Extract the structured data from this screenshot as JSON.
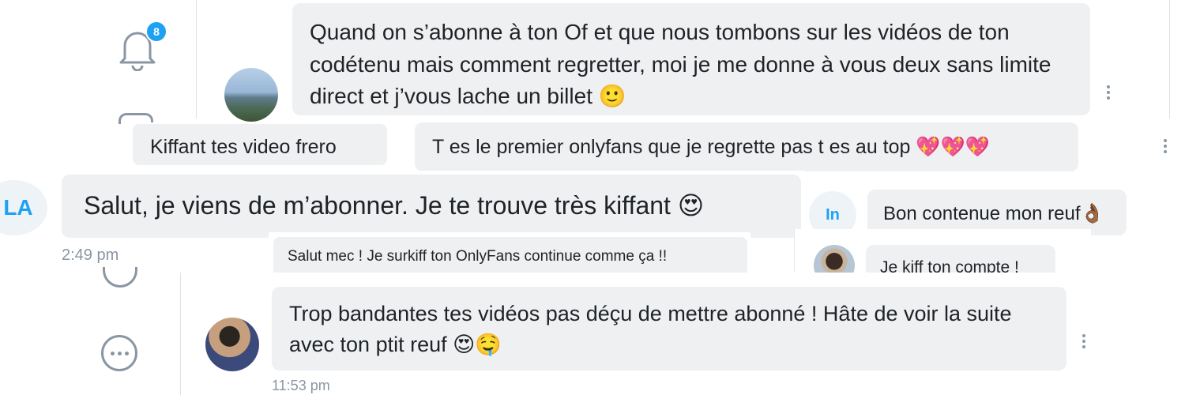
{
  "notifications": {
    "badge_count": "8",
    "icon": "bell-icon"
  },
  "messages": [
    {
      "text": "Quand on s’abonne à ton Of et que nous tombons sur les vidéos de ton codétenu mais comment regretter, moi je me donne à vous deux sans limite direct et j’vous lache un billet",
      "emoji": "🙂",
      "avatar": "landscape-photo"
    },
    {
      "text": "Kiffant tes video frero"
    },
    {
      "text": "T es le premier onlyfans que je regrette pas t es au top",
      "emoji": "💖💖💖"
    },
    {
      "text": "Salut, je viens de m’abonner. Je te trouve très kiffant",
      "emoji": "😍",
      "avatar_initials": "LA",
      "time": "2:49 pm"
    },
    {
      "text": "Bon contenue mon reuf",
      "emoji": "👌🏾",
      "avatar_initials": "In"
    },
    {
      "text": "Salut mec ! Je surkiff ton OnlyFans continue comme ça !!"
    },
    {
      "text": "Je kiff ton compte !",
      "avatar": "person-photo"
    },
    {
      "text": "Trop bandantes tes vidéos pas déçu de mettre abonné ! Hâte de voir la suite avec ton ptit reuf",
      "emoji": "😍🤤",
      "avatar": "sunglasses-person-photo",
      "time": "11:53 pm"
    }
  ],
  "colors": {
    "bubble": "#eef0f2",
    "accent": "#1da1f2",
    "muted": "#8a96a3"
  }
}
